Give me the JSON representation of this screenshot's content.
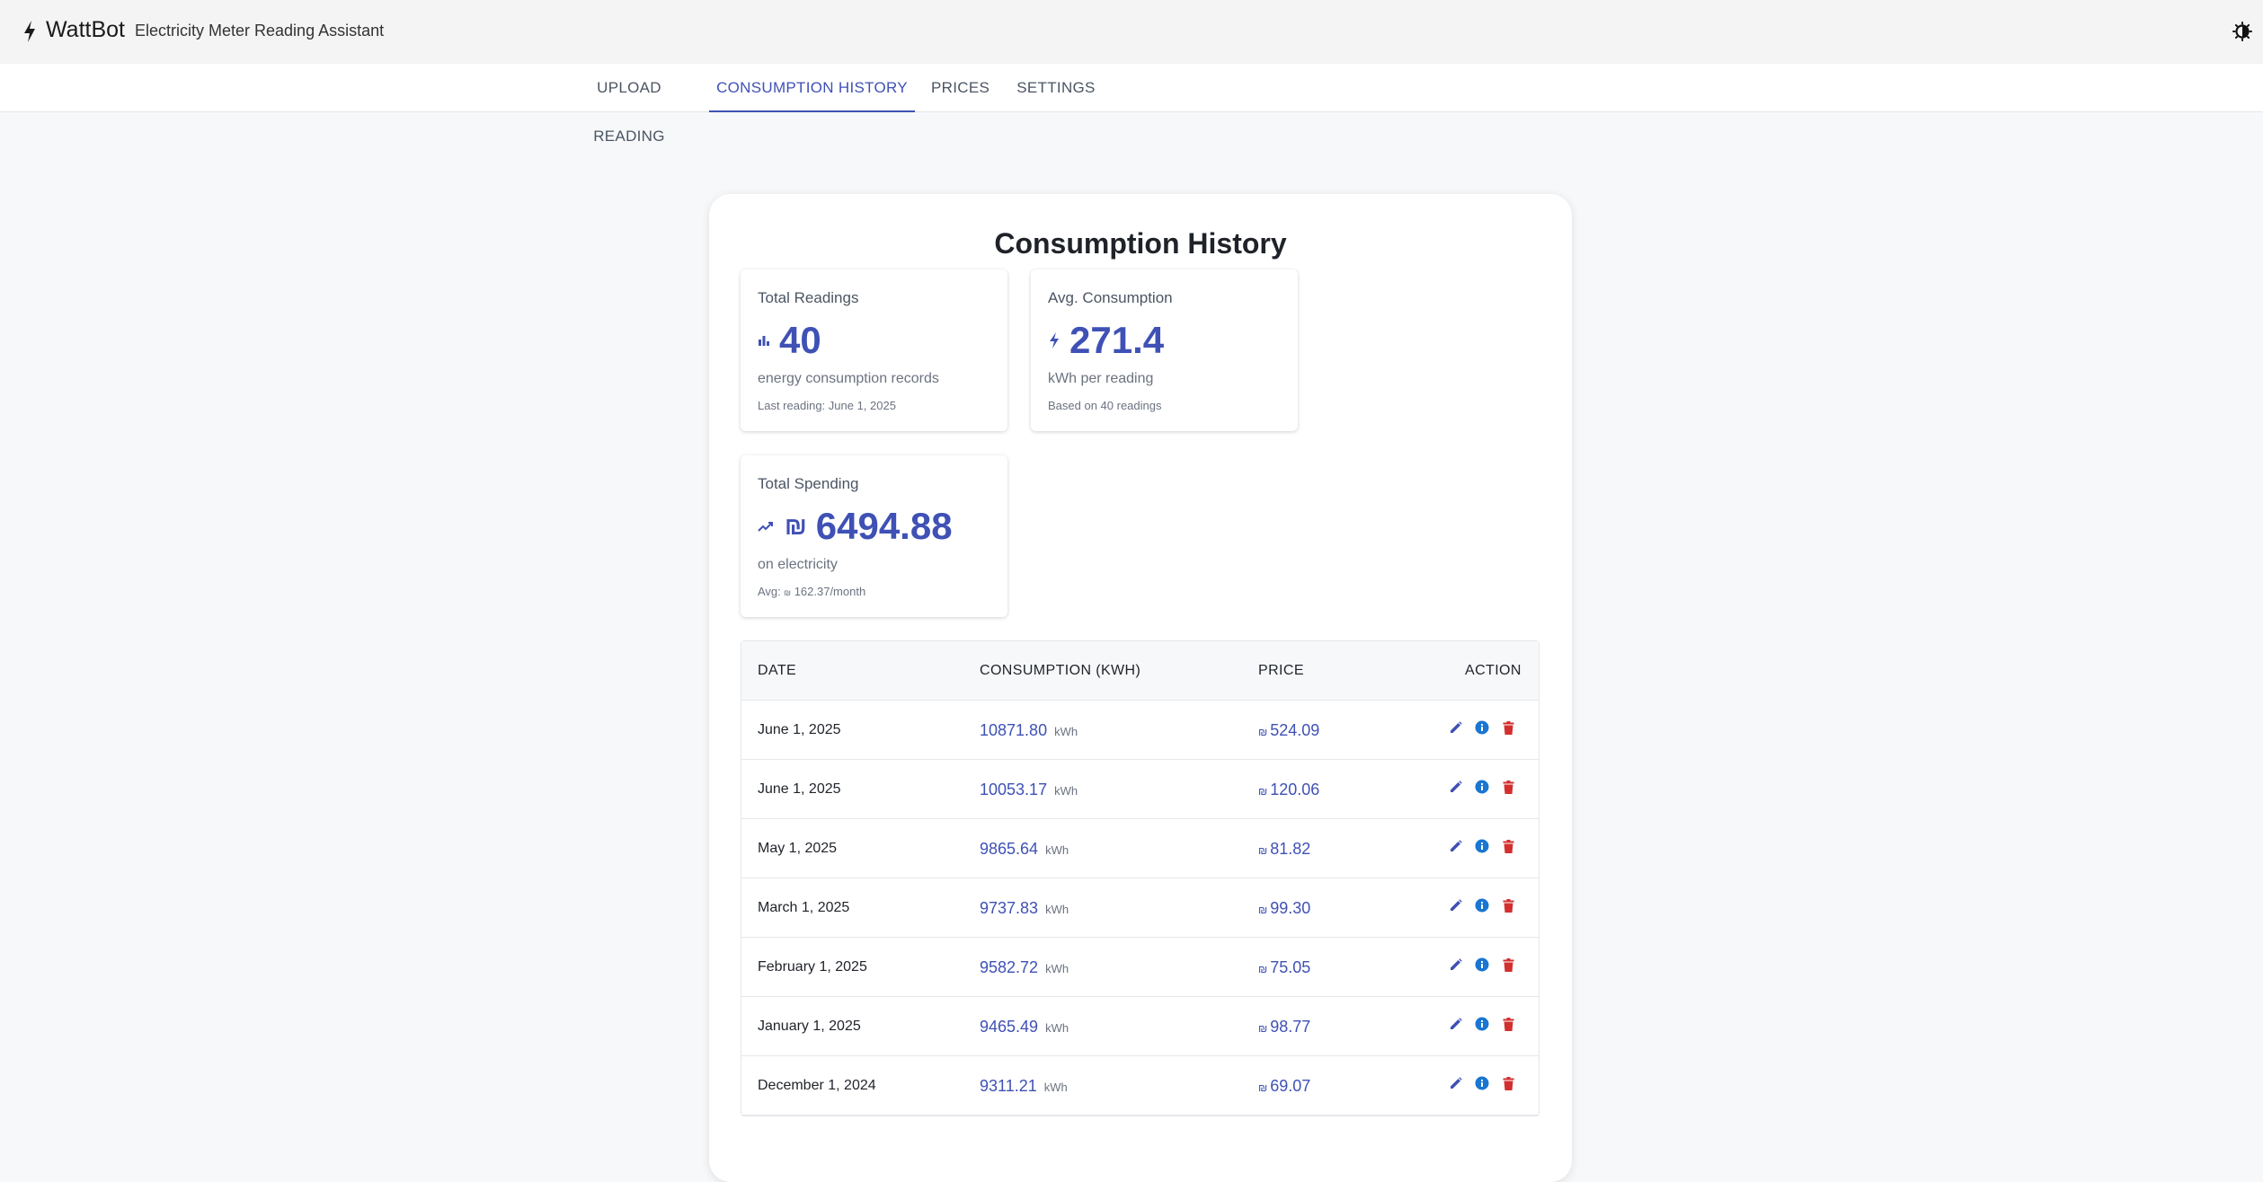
{
  "app": {
    "name": "WattBot",
    "subtitle": "Electricity Meter Reading Assistant"
  },
  "tabs": [
    {
      "label": "UPLOAD READING",
      "active": false
    },
    {
      "label": "CONSUMPTION HISTORY",
      "active": true
    },
    {
      "label": "PRICES",
      "active": false
    },
    {
      "label": "SETTINGS",
      "active": false
    }
  ],
  "page": {
    "title": "Consumption History"
  },
  "stats": {
    "total_readings": {
      "label": "Total Readings",
      "value": "40",
      "desc": "energy consumption records",
      "sub": "Last reading: June 1, 2025"
    },
    "avg_consumption": {
      "label": "Avg. Consumption",
      "value": "271.4",
      "desc": "kWh per reading",
      "sub": "Based on 40 readings"
    },
    "total_spending": {
      "label": "Total Spending",
      "currency": "₪",
      "value": "6494.88",
      "desc": "on electricity",
      "sub_prefix": "Avg:",
      "sub_currency": "₪",
      "sub_value": "162.37/month"
    }
  },
  "table": {
    "headers": {
      "date": "DATE",
      "consumption": "CONSUMPTION (KWH)",
      "price": "PRICE",
      "action": "ACTION"
    },
    "unit": "kWh",
    "currency": "₪",
    "rows": [
      {
        "date": "June 1, 2025",
        "consumption": "10871.80",
        "price": "524.09"
      },
      {
        "date": "June 1, 2025",
        "consumption": "10053.17",
        "price": "120.06"
      },
      {
        "date": "May 1, 2025",
        "consumption": "9865.64",
        "price": "81.82"
      },
      {
        "date": "March 1, 2025",
        "consumption": "9737.83",
        "price": "99.30"
      },
      {
        "date": "February 1, 2025",
        "consumption": "9582.72",
        "price": "75.05"
      },
      {
        "date": "January 1, 2025",
        "consumption": "9465.49",
        "price": "98.77"
      },
      {
        "date": "December 1, 2024",
        "consumption": "9311.21",
        "price": "69.07"
      }
    ]
  },
  "colors": {
    "primary": "#3f51b5",
    "info": "#1976d2",
    "danger": "#d32f2f"
  },
  "icons": {
    "brand": "bolt-icon",
    "theme": "theme-toggle-icon",
    "readings": "bar-chart-icon",
    "consumption": "bolt-icon",
    "spending": "trending-up-icon",
    "edit": "edit-icon",
    "info": "info-icon",
    "delete": "delete-icon"
  }
}
